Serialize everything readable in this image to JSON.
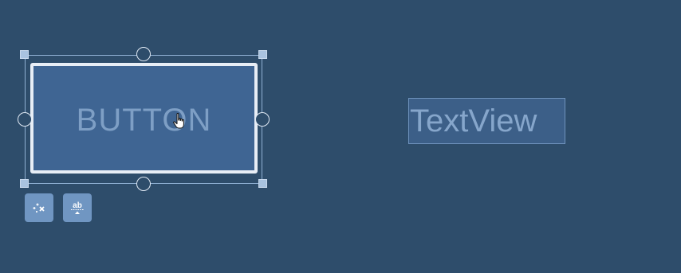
{
  "canvas": {
    "background": "#2e4d6b"
  },
  "button_widget": {
    "label": "BUTTON",
    "selected": true
  },
  "textview_widget": {
    "label": "TextView"
  },
  "actions": [
    {
      "name": "clear-constraints-icon"
    },
    {
      "name": "baseline-icon",
      "glyph": "ab"
    }
  ],
  "cursor": {
    "icon": "hand-pointer-icon"
  }
}
